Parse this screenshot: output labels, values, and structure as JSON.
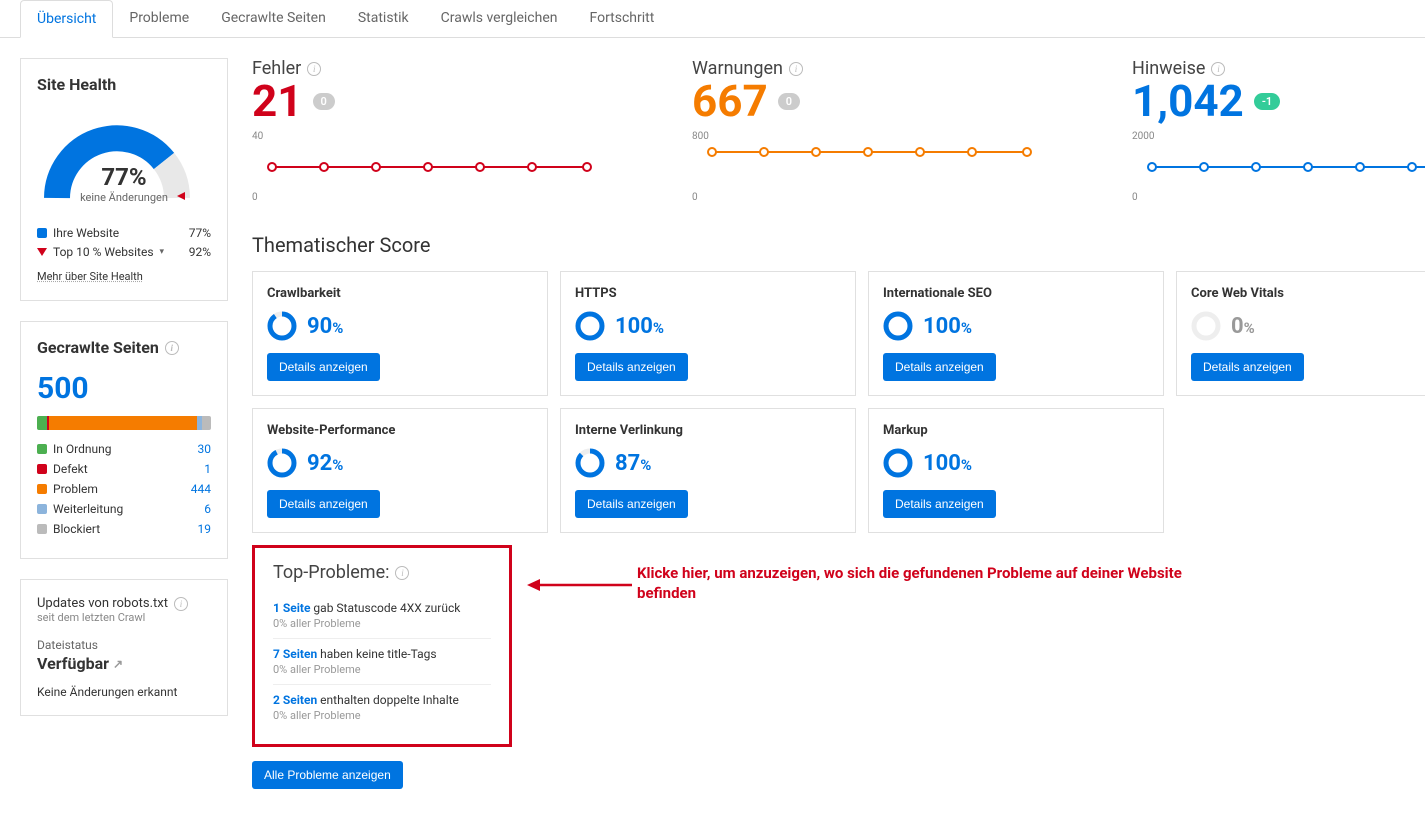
{
  "tabs": [
    "Übersicht",
    "Probleme",
    "Gecrawlte Seiten",
    "Statistik",
    "Crawls vergleichen",
    "Fortschritt"
  ],
  "activeTab": 0,
  "siteHealth": {
    "title": "Site Health",
    "percent": "77%",
    "sub": "keine Änderungen",
    "legend1": {
      "label": "Ihre Website",
      "value": "77%",
      "color": "#0074e0"
    },
    "legend2": {
      "label": "Top 10 % Websites",
      "value": "92%",
      "color": "#d0021b"
    },
    "link": "Mehr über Site Health"
  },
  "crawled": {
    "title": "Gecrawlte Seiten",
    "total": "500",
    "rows": [
      {
        "label": "In Ordnung",
        "value": "30",
        "color": "#4caf50"
      },
      {
        "label": "Defekt",
        "value": "1",
        "color": "#d0021b"
      },
      {
        "label": "Problem",
        "value": "444",
        "color": "#f57c00"
      },
      {
        "label": "Weiterleitung",
        "value": "6",
        "color": "#8cb4dc"
      },
      {
        "label": "Blockiert",
        "value": "19",
        "color": "#bbb"
      }
    ]
  },
  "robots": {
    "title": "Updates von robots.txt",
    "sub": "seit dem letzten Crawl",
    "fileLabel": "Dateistatus",
    "fileStatus": "Verfügbar",
    "noChanges": "Keine Änderungen erkannt"
  },
  "metrics": {
    "errors": {
      "title": "Fehler",
      "value": "21",
      "delta": "0",
      "color": "#d0021b",
      "axisTop": "40",
      "axisBot": "0"
    },
    "warnings": {
      "title": "Warnungen",
      "value": "667",
      "delta": "0",
      "color": "#f57c00",
      "axisTop": "800",
      "axisBot": "0"
    },
    "notices": {
      "title": "Hinweise",
      "value": "1,042",
      "delta": "-1",
      "color": "#0074e0",
      "axisTop": "2000",
      "axisBot": "0"
    }
  },
  "thematic": {
    "title": "Thematischer Score",
    "cards": [
      {
        "name": "Crawlbarkeit",
        "value": 90,
        "display": "90"
      },
      {
        "name": "HTTPS",
        "value": 100,
        "display": "100"
      },
      {
        "name": "Internationale SEO",
        "value": 100,
        "display": "100"
      },
      {
        "name": "Core Web Vitals",
        "value": 0,
        "display": "0",
        "grey": true
      },
      {
        "name": "Website-Performance",
        "value": 92,
        "display": "92"
      },
      {
        "name": "Interne Verlinkung",
        "value": 87,
        "display": "87"
      },
      {
        "name": "Markup",
        "value": 100,
        "display": "100"
      }
    ],
    "btn": "Details anzeigen"
  },
  "topProblems": {
    "title": "Top-Probleme:",
    "items": [
      {
        "count": "1 Seite",
        "text": " gab Statuscode 4XX zurück",
        "sub": "0% aller Probleme"
      },
      {
        "count": "7 Seiten",
        "text": " haben keine title-Tags",
        "sub": "0% aller Probleme"
      },
      {
        "count": "2 Seiten",
        "text": " enthalten doppelte Inhalte",
        "sub": "0% aller Probleme"
      }
    ],
    "btnAll": "Alle Probleme anzeigen",
    "annotation": "Klicke hier, um anzuzeigen, wo sich die gefundenen Probleme auf deiner Website befinden"
  },
  "chart_data": [
    {
      "type": "line",
      "title": "Fehler",
      "x": [
        1,
        2,
        3,
        4,
        5,
        6,
        7
      ],
      "values": [
        21,
        21,
        21,
        21,
        21,
        21,
        21
      ],
      "ylim": [
        0,
        40
      ],
      "ylabel": "",
      "xlabel": ""
    },
    {
      "type": "line",
      "title": "Warnungen",
      "x": [
        1,
        2,
        3,
        4,
        5,
        6,
        7
      ],
      "values": [
        667,
        667,
        667,
        667,
        667,
        667,
        667
      ],
      "ylim": [
        0,
        800
      ],
      "ylabel": "",
      "xlabel": ""
    },
    {
      "type": "line",
      "title": "Hinweise",
      "x": [
        1,
        2,
        3,
        4,
        5,
        6,
        7
      ],
      "values": [
        1043,
        1042,
        1042,
        1042,
        1042,
        1042,
        1042
      ],
      "ylim": [
        0,
        2000
      ],
      "ylabel": "",
      "xlabel": ""
    }
  ]
}
